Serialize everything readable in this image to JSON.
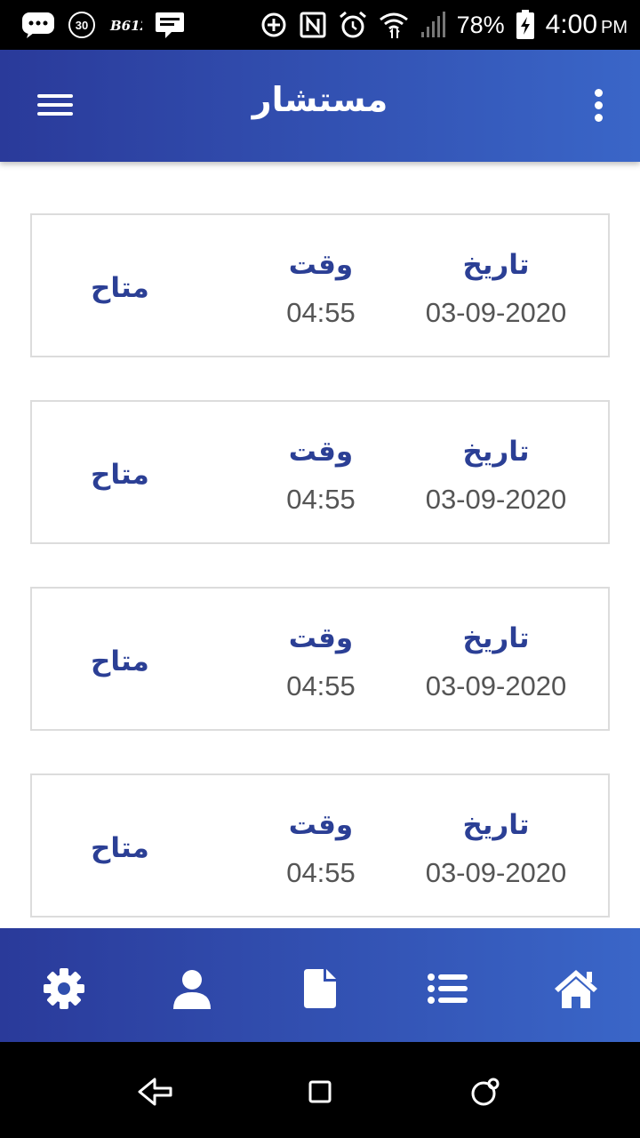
{
  "status_bar": {
    "time": "4:00",
    "am_pm": "PM",
    "battery_percent": "78%",
    "left_icons": [
      "chat-bubble-icon",
      "badge-30-icon",
      "b612-icon",
      "message-icon"
    ],
    "right_icons": [
      "data-saver-icon",
      "nfc-icon",
      "alarm-icon",
      "wifi-icon",
      "signal-icon",
      "battery-charging-icon"
    ],
    "badge_number": "30",
    "b612_text": "B612"
  },
  "header": {
    "title": "مستشار",
    "menu_icon": "hamburger-menu-icon",
    "more_icon": "more-vert-icon"
  },
  "appointments": [
    {
      "date_label": "تاريخ",
      "date": "03-09-2020",
      "time_label": "وقت",
      "time": "04:55",
      "status": "متاح"
    },
    {
      "date_label": "تاريخ",
      "date": "03-09-2020",
      "time_label": "وقت",
      "time": "04:55",
      "status": "متاح"
    },
    {
      "date_label": "تاريخ",
      "date": "03-09-2020",
      "time_label": "وقت",
      "time": "04:55",
      "status": "متاح"
    },
    {
      "date_label": "تاريخ",
      "date": "03-09-2020",
      "time_label": "وقت",
      "time": "04:55",
      "status": "متاح"
    }
  ],
  "bottom_nav": {
    "items": [
      "settings-icon",
      "profile-icon",
      "document-icon",
      "list-icon",
      "home-icon"
    ]
  },
  "system_nav": {
    "items": [
      "back-icon",
      "recents-icon",
      "home-circle-icon"
    ]
  },
  "colors": {
    "accent_dark": "#2a3a9a",
    "accent_light": "#3a66c8",
    "label_blue": "#2b3f95",
    "value_gray": "#555555"
  }
}
